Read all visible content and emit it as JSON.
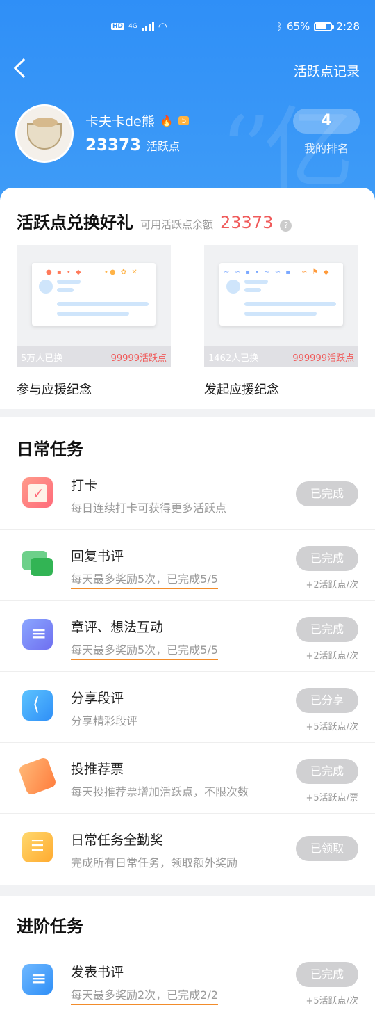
{
  "status_bar": {
    "hd_badge": "HD",
    "network": "4G",
    "battery": "65%",
    "time": "2:28"
  },
  "topbar": {
    "record_link": "活跃点记录"
  },
  "profile": {
    "name": "卡夫卡de熊",
    "level": "5",
    "points": "23373",
    "points_unit": "活跃点",
    "rank_value": "4",
    "rank_label": "我的排名"
  },
  "exchange": {
    "title": "活跃点兑换好礼",
    "available_label": "可用活跃点余额",
    "available_amount": "23373",
    "help_icon": "?",
    "gifts": [
      {
        "count": "5万人已换",
        "price": "99999活跃点",
        "name": "参与应援纪念"
      },
      {
        "count": "1462人已换",
        "price": "999999活跃点",
        "name": "发起应援纪念"
      }
    ]
  },
  "daily": {
    "title": "日常任务",
    "tasks": [
      {
        "icon": "calendar-icon",
        "title": "打卡",
        "subtitle": "每日连续打卡可获得更多活跃点",
        "button": "已完成",
        "reward": ""
      },
      {
        "icon": "chat-bubbles-icon",
        "title": "回复书评",
        "subtitle": "每天最多奖励5次，已完成5/5",
        "button": "已完成",
        "reward": "+2活跃点/次"
      },
      {
        "icon": "notes-icon",
        "title": "章评、想法互动",
        "subtitle": "每天最多奖励5次，已完成5/5",
        "button": "已完成",
        "reward": "+2活跃点/次"
      },
      {
        "icon": "share-icon",
        "title": "分享段评",
        "subtitle": "分享精彩段评",
        "button": "已分享",
        "reward": "+5活跃点/次"
      },
      {
        "icon": "ticket-icon",
        "title": "投推荐票",
        "subtitle": "每天投推荐票增加活跃点，不限次数",
        "button": "已完成",
        "reward": "+5活跃点/票"
      },
      {
        "icon": "list-icon",
        "title": "日常任务全勤奖",
        "subtitle": "完成所有日常任务，领取额外奖励",
        "button": "已领取",
        "reward": ""
      }
    ]
  },
  "advanced": {
    "title": "进阶任务",
    "tasks": [
      {
        "icon": "document-icon",
        "title": "发表书评",
        "subtitle": "每天最多奖励2次，已完成2/2",
        "button": "已完成",
        "reward": "+5活跃点/次"
      }
    ]
  }
}
